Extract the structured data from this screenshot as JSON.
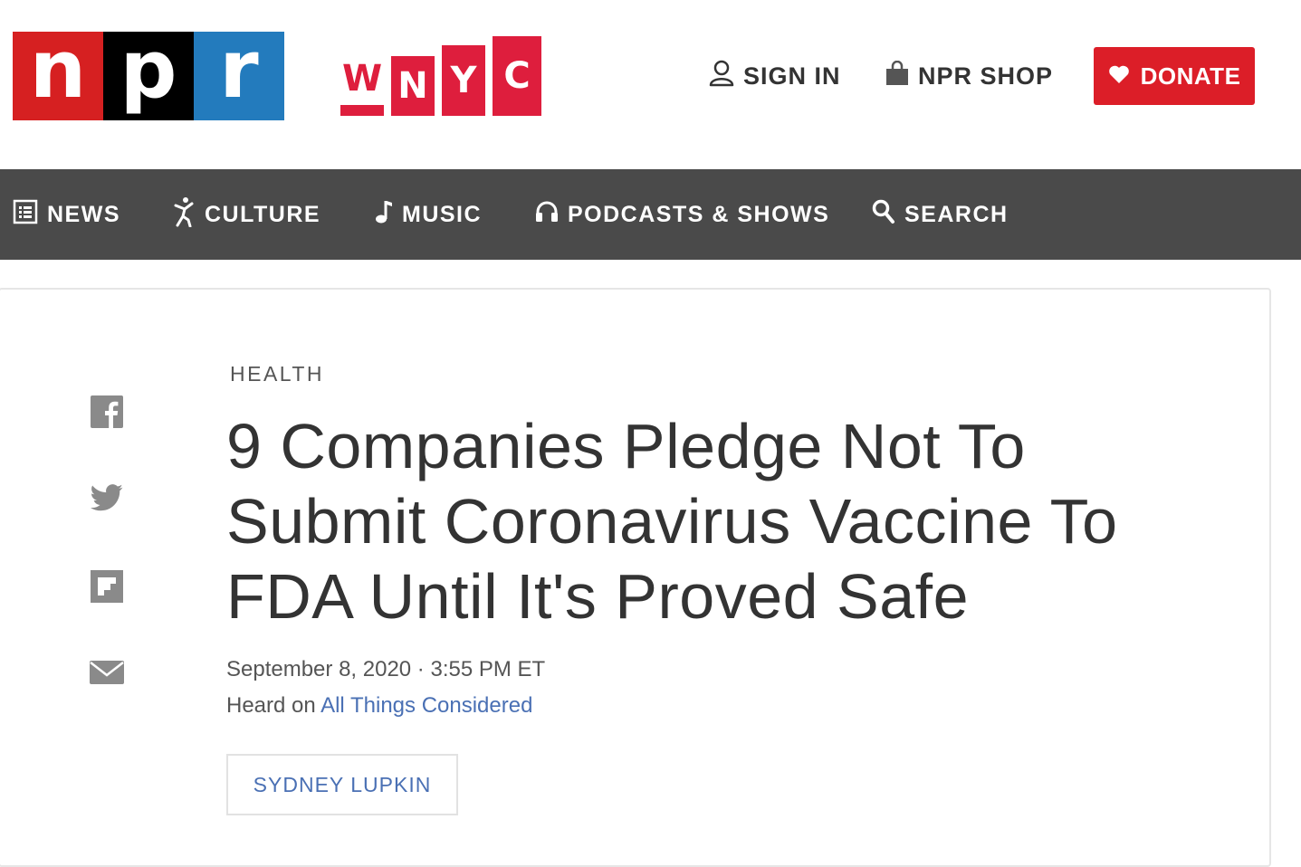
{
  "header": {
    "npr_logo": [
      "n",
      "p",
      "r"
    ],
    "wnyc_logo": [
      "W",
      "N",
      "Y",
      "C"
    ],
    "sign_in": "SIGN IN",
    "shop": "NPR SHOP",
    "donate": "DONATE"
  },
  "nav": {
    "news": "NEWS",
    "culture": "CULTURE",
    "music": "MUSIC",
    "podcasts": "PODCASTS & SHOWS",
    "search": "SEARCH"
  },
  "article": {
    "slug": "HEALTH",
    "headline": "9 Companies Pledge Not To Submit Coronavirus Vaccine To FDA Until It's Proved Safe",
    "date": "September 8, 2020 · 3:55 PM ET",
    "heard_prefix": "Heard on",
    "program": "All Things Considered",
    "author": "SYDNEY LUPKIN"
  },
  "share_icons": [
    "facebook-icon",
    "twitter-icon",
    "flipboard-icon",
    "email-icon"
  ],
  "colors": {
    "npr_red": "#d62021",
    "npr_black": "#000000",
    "npr_blue": "#237bbd",
    "wnyc_red": "#de1e3d",
    "donate_red": "#dc1e28",
    "nav_bg": "#4a4a4a",
    "link_blue": "#4a70b4"
  }
}
